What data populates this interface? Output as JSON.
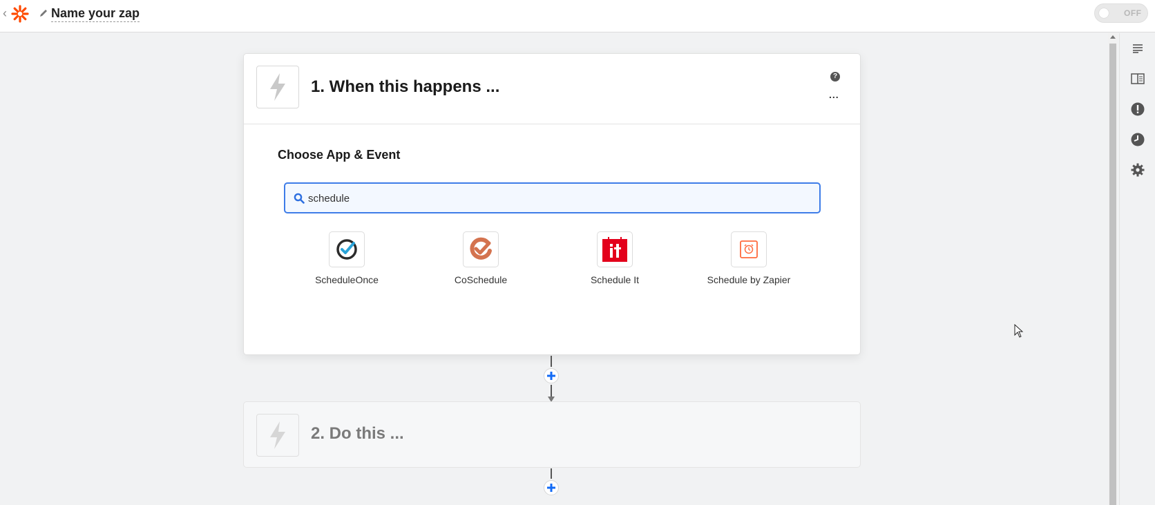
{
  "header": {
    "zap_name": "Name your zap",
    "toggle_label": "OFF"
  },
  "colors": {
    "brand": "#ff4a00",
    "accent": "#3d7ce8",
    "add_button": "#136bf5"
  },
  "step1": {
    "title": "1. When this happens ...",
    "section_title": "Choose App & Event",
    "search_value": "schedule",
    "apps": [
      {
        "label": "ScheduleOnce",
        "icon": "scheduleonce-check-icon"
      },
      {
        "label": "CoSchedule",
        "icon": "coschedule-check-icon"
      },
      {
        "label": "Schedule It",
        "icon": "schedule-it-logo-icon"
      },
      {
        "label": "Schedule by Zapier",
        "icon": "alarm-clock-icon"
      }
    ]
  },
  "step2": {
    "title": "2. Do this ..."
  },
  "rail": {
    "icons": [
      "outline-icon",
      "book-icon",
      "alert-icon",
      "history-icon",
      "gear-icon"
    ]
  }
}
